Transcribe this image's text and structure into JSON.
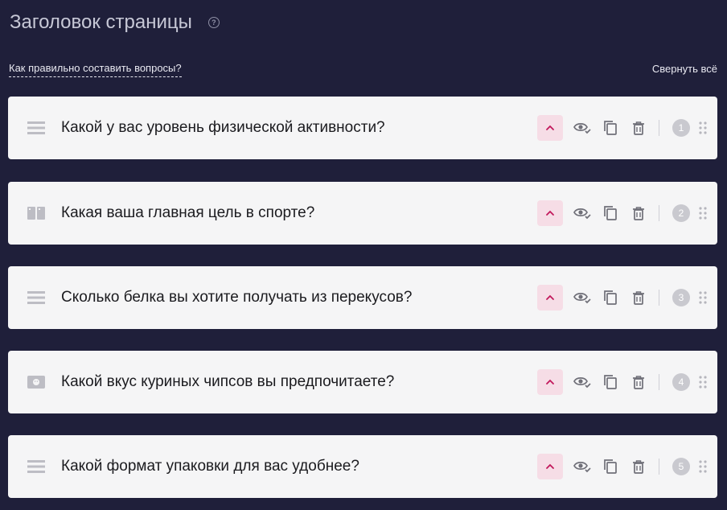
{
  "page": {
    "title": "Заголовок страницы",
    "help_icon": "help-circle-icon",
    "help_glyph": "?"
  },
  "links": {
    "how_to": "Как правильно составить вопросы?",
    "collapse_all": "Свернуть всё"
  },
  "colors": {
    "background": "#1f1f3a",
    "card": "#f5f5f6",
    "accent": "#c2185b",
    "accent_bg": "#f6dde6"
  },
  "questions": [
    {
      "text": "Какой у вас уровень физической активности?",
      "number": "1",
      "type_icon": "list-icon"
    },
    {
      "text": "Какая ваша главная цель в спорте?",
      "number": "2",
      "type_icon": "columns-icon"
    },
    {
      "text": "Сколько белка вы хотите получать из перекусов?",
      "number": "3",
      "type_icon": "list-icon"
    },
    {
      "text": "Какой вкус куриных чипсов вы предпочитаете?",
      "number": "4",
      "type_icon": "emoji-image-icon"
    },
    {
      "text": "Какой формат упаковки для вас удобнее?",
      "number": "5",
      "type_icon": "list-icon"
    }
  ]
}
